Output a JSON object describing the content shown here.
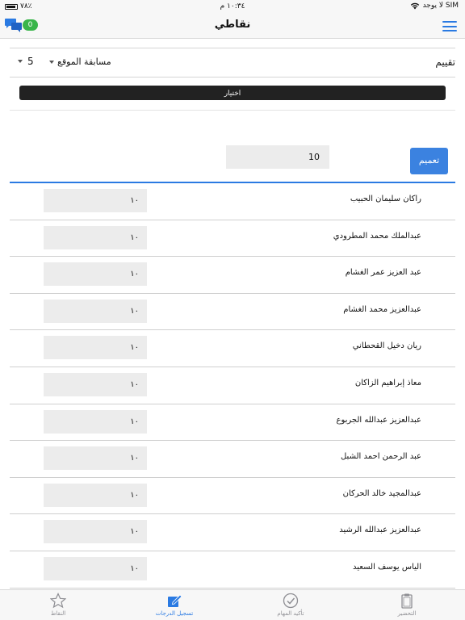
{
  "status": {
    "carrier": "لا يوجد SIM",
    "time": "١٠:٣٤ م",
    "battery": "٧٨٪"
  },
  "nav": {
    "title": "نقاطي",
    "badge_count": "0"
  },
  "rating": {
    "label": "تقييم",
    "competition": "مسابقة الموقع",
    "number": "5"
  },
  "choose_label": "اختيار",
  "score_all": "10",
  "apply_label": "تعميم",
  "students": [
    {
      "name": "راكان سليمان الحبيب",
      "score": "١٠"
    },
    {
      "name": "عبدالملك محمد المطرودي",
      "score": "١٠"
    },
    {
      "name": "عبد العزيز عمر الغشام",
      "score": "١٠"
    },
    {
      "name": "عبدالعزيز محمد الغشام",
      "score": "١٠"
    },
    {
      "name": "ريان دخيل القحطاني",
      "score": "١٠"
    },
    {
      "name": "معاذ إبراهيم الزاكان",
      "score": "١٠"
    },
    {
      "name": "عبدالعزيز عبدالله الجربوع",
      "score": "١٠"
    },
    {
      "name": "عبد الرحمن احمد الشبل",
      "score": "١٠"
    },
    {
      "name": "عبدالمجيد خالد الحركان",
      "score": "١٠"
    },
    {
      "name": "عبدالعزيز عبدالله الرشيد",
      "score": "١٠"
    },
    {
      "name": "الياس يوسف السعيد",
      "score": "١٠"
    }
  ],
  "tabs": [
    {
      "label": "التحضير",
      "icon": "clipboard-icon"
    },
    {
      "label": "تأكيد المهام",
      "icon": "check-circle-icon"
    },
    {
      "label": "تسجيل الدرجات",
      "icon": "edit-icon"
    },
    {
      "label": "النقاط",
      "icon": "star-icon"
    }
  ],
  "colors": {
    "accent": "#2a7ae2",
    "badge": "#39b54a",
    "button_dark": "#222222"
  }
}
